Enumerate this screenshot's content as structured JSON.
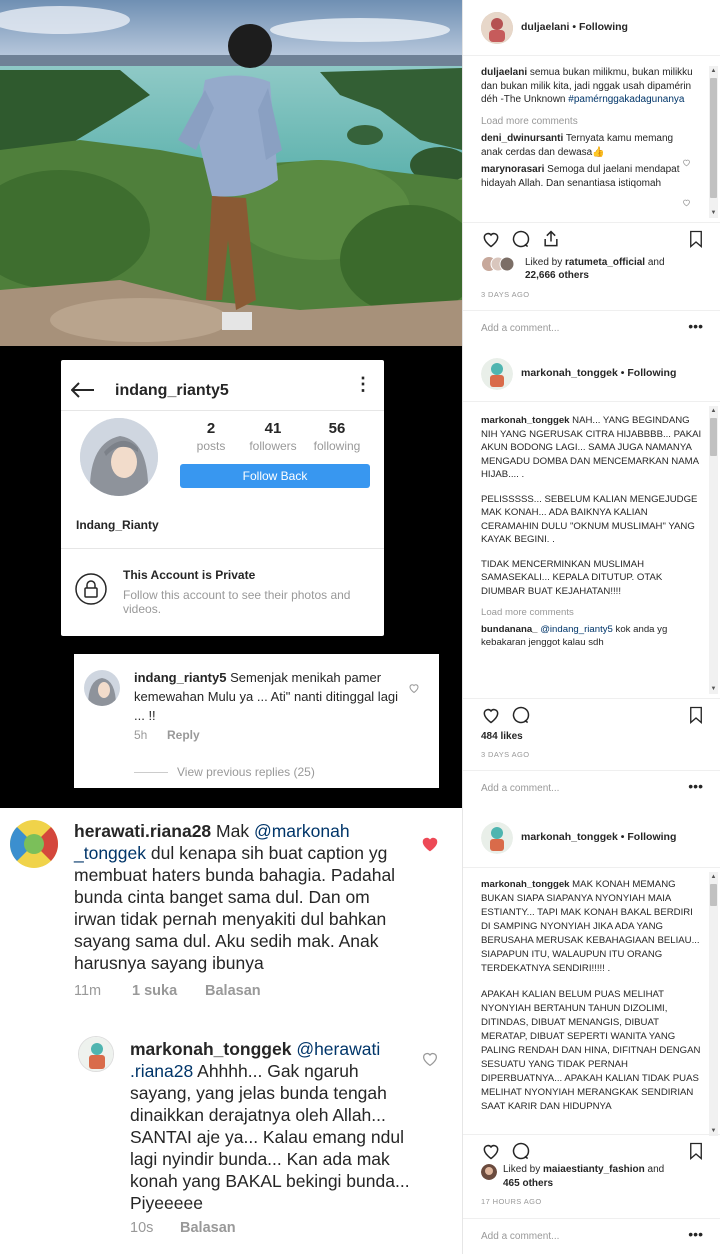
{
  "post1": {
    "username": "duljaelani",
    "follow_status": "Following",
    "caption_user": "duljaelani",
    "caption_text": "semua bukan milikmu, bukan milikku dan bukan milik kita, jadi nggak usah dipamérin déh -The Unknown",
    "caption_hashtag": "#pamérnggakadagunanya",
    "load_more": "Load more comments",
    "comments": [
      {
        "user": "deni_dwinursanti",
        "text": "Ternyata kamu memang anak cerdas dan dewasa👍"
      },
      {
        "user": "marynorasari",
        "text": "Semoga dul jaelani mendapat hidayah Allah. Dan senantiasa istiqomah"
      }
    ],
    "liked_by_prefix": "Liked by",
    "liked_by_user": "ratumeta_official",
    "liked_by_suffix": "and",
    "liked_by_count": "22,666 others",
    "timestamp": "3 DAYS AGO",
    "add_comment": "Add a comment...",
    "more": "•••"
  },
  "profile": {
    "back_icon": "arrow-left-icon",
    "username": "indang_rianty5",
    "posts_count": "2",
    "posts_label": "posts",
    "followers_count": "41",
    "followers_label": "followers",
    "following_count": "56",
    "following_label": "following",
    "follow_back_label": "Follow Back",
    "display_name": "Indang_Rianty",
    "private_title": "This Account is Private",
    "private_desc": "Follow this account to see their photos and videos.",
    "accent_color": "#3897f0"
  },
  "comment_card": {
    "user": "indang_rianty5",
    "text": "Semenjak menikah pamer kemewahan Mulu ya ... Ati\" nanti ditinggal lagi ... !!",
    "time": "5h",
    "reply": "Reply",
    "view_replies": "View previous replies (25)"
  },
  "bottom_thread": {
    "c1_user": "herawati.riana28",
    "c1_pre": "Mak",
    "c1_mention": "@markonah _tonggek",
    "c1_text": "dul kenapa sih buat caption yg membuat haters bunda bahagia. Padahal bunda cinta banget sama dul. Dan om irwan tidak pernah menyakiti dul bahkan sayang sama dul. Aku sedih mak. Anak harusnya sayang ibunya",
    "c1_time": "11m",
    "c1_likes": "1 suka",
    "c1_reply": "Balasan",
    "c2_user": "markonah_tonggek",
    "c2_mention": "@herawati .riana28",
    "c2_text": "Ahhhh... Gak ngaruh sayang, yang jelas bunda tengah dinaikkan derajatnya oleh Allah... SANTAI aje ya... Kalau emang ndul lagi nyindir bunda... Kan ada mak konah yang BAKAL bekingi bunda... Piyeeeee",
    "c2_time": "10s",
    "c2_reply": "Balasan",
    "liked_color": "#ed4956"
  },
  "post2": {
    "username": "markonah_tonggek",
    "follow_status": "Following",
    "caption_user": "markonah_tonggek",
    "caption_p1": "NAH... YANG BEGINDANG NIH YANG NGERUSAK CITRA HIJABBBB... PAKAI AKUN BODONG LAGI... SAMA JUGA NAMANYA MENGADU DOMBA DAN MENCEMARKAN NAMA HIJAB.... .",
    "caption_p2": "PELISSSSS... SEBELUM KALIAN MENGEJUDGE MAK KONAH... ADA BAIKNYA KALIAN CERAMAHIN DULU \"OKNUM MUSLIMAH\" YANG KAYAK BEGINI. .",
    "caption_p3": "TIDAK MENCERMINKAN MUSLIMAH SAMASEKALI... KEPALA DITUTUP. OTAK DIUMBAR BUAT KEJAHATAN!!!!",
    "load_more": "Load more comments",
    "comment_user": "bundanana_",
    "comment_mention": "@indang_rianty5",
    "comment_text": "kok anda yg kebakaran jenggot kalau sdh",
    "likes": "484 likes",
    "timestamp": "3 DAYS AGO",
    "add_comment": "Add a comment...",
    "more": "•••"
  },
  "post3": {
    "username": "markonah_tonggek",
    "follow_status": "Following",
    "caption_user": "markonah_tonggek",
    "caption_p1": "MAK KONAH MEMANG BUKAN SIAPA SIAPANYA NYONYIAH MAIA ESTIANTY... TAPI MAK KONAH BAKAL BERDIRI DI SAMPING NYONYIAH JIKA ADA YANG BERUSAHA MERUSAK KEBAHAGIAAN BELIAU... SIAPAPUN ITU, WALAUPUN ITU ORANG TERDEKATNYA SENDIRI!!!!! .",
    "caption_p2": "APAKAH KALIAN BELUM PUAS MELIHAT NYONYIAH BERTAHUN TAHUN DIZOLIMI, DITINDAS, DIBUAT MENANGIS, DIBUAT MERATAP, DIBUAT SEPERTI WANITA YANG PALING RENDAH DAN HINA, DIFITNAH DENGAN SESUATU YANG TIDAK PERNAH DIPERBUATNYA... APAKAH KALIAN TIDAK PUAS MELIHAT NYONYIAH MERANGKAK SENDIRIAN SAAT KARIR DAN HIDUPNYA",
    "liked_by_prefix": "Liked by",
    "liked_by_user": "maiaestianty_fashion",
    "liked_by_suffix": "and",
    "liked_by_count": "465 others",
    "timestamp": "17 HOURS AGO",
    "add_comment": "Add a comment...",
    "more": "•••"
  }
}
